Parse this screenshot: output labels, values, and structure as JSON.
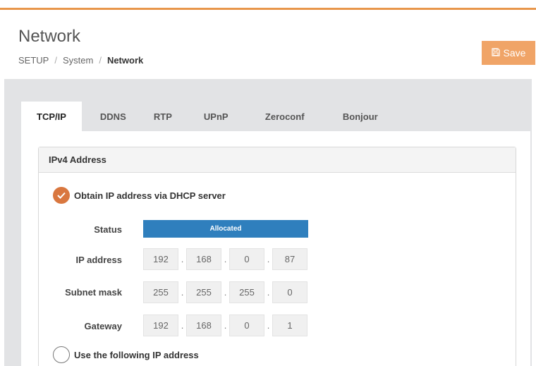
{
  "header": {
    "title": "Network",
    "breadcrumb": [
      "SETUP",
      "System",
      "Network"
    ],
    "save_label": "Save"
  },
  "tabs": [
    {
      "label": "TCP/IP",
      "active": true
    },
    {
      "label": "DDNS",
      "active": false
    },
    {
      "label": "RTP",
      "active": false
    },
    {
      "label": "UPnP",
      "active": false
    },
    {
      "label": "Zeroconf",
      "active": false
    },
    {
      "label": "Bonjour",
      "active": false
    }
  ],
  "ipv4": {
    "title": "IPv4 Address",
    "dhcp_label": "Obtain IP address via DHCP server",
    "dhcp_selected": true,
    "status_label": "Status",
    "status_value": "Allocated",
    "ip_label": "IP address",
    "ip": [
      "192",
      "168",
      "0",
      "87"
    ],
    "subnet_label": "Subnet mask",
    "subnet": [
      "255",
      "255",
      "255",
      "0"
    ],
    "gateway_label": "Gateway",
    "gateway": [
      "192",
      "168",
      "0",
      "1"
    ],
    "static_label": "Use the following IP address",
    "static_selected": false
  },
  "colors": {
    "accent": "#e8964a",
    "save_button": "#f0a467",
    "radio_checked": "#d9773f",
    "status_bar": "#2f7fbd"
  },
  "icons": {
    "save": "floppy-disk-icon",
    "radio_checked": "checkmark-icon"
  }
}
